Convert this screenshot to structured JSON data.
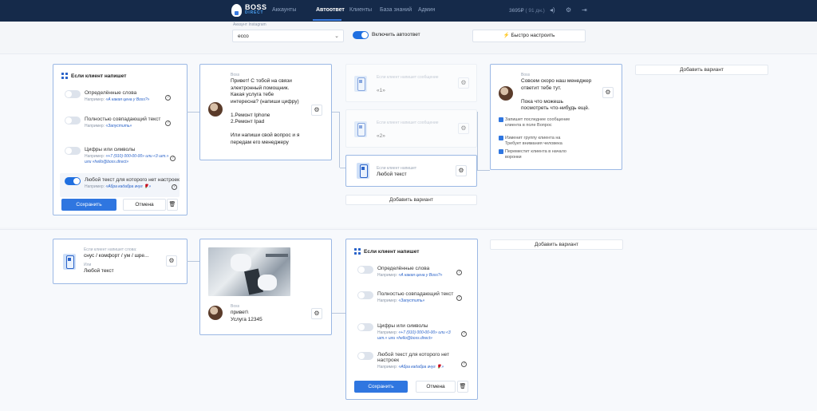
{
  "header": {
    "logo_line1": "BOSS",
    "logo_line2": "DIRECT",
    "nav": [
      {
        "label": "Аккаунты",
        "active": false
      },
      {
        "label": "Автоответ",
        "active": true
      },
      {
        "label": "Клиенты",
        "active": false
      },
      {
        "label": "База знаний",
        "active": false
      },
      {
        "label": "Админ",
        "active": false
      }
    ],
    "balance": "3695₽",
    "balance_days": "( 91 дн.)"
  },
  "account": {
    "label": "Аккаунт Instagram",
    "value": "ecco",
    "autoreply_label": "Включить автоответ",
    "autoreply_on": true,
    "quick_setup": "Быстро настроить"
  },
  "trigger_card": {
    "title": "Если клиент напишет",
    "options": [
      {
        "name": "Определённые слова",
        "hint_prefix": "Например: ",
        "hint": "«А какая цена у Boss?»",
        "on": false
      },
      {
        "name": "Полностью совпадающий текст",
        "hint_prefix": "Например: ",
        "hint": "«Запустить»",
        "on": false
      },
      {
        "name": "Цифры или символы",
        "hint_prefix": "Например: ",
        "hint": "«+7 (910) 000-00-00» или «3 шт.» или «hello@boss.direct»",
        "on": false
      },
      {
        "name": "Любой текст для которого нет настроек",
        "hint_prefix": "Например: ",
        "hint": "«Абра кадабра ачуг 🌹»",
        "on": true
      }
    ],
    "save": "Сохранить",
    "cancel": "Отмена"
  },
  "reply1": {
    "author": "Boss",
    "text": "Привет! С тобой на связи\nэлектронный помощник.\nКакая услуга тебе\nинтересна? (напиши цифру)\n\n1.Ремонт Iphone\n2.Ремонт Ipad\n\nИли напиши свой вопрос и я\nпередам его менеджеру"
  },
  "branches": [
    {
      "label": "Если клиент напишет сообщение",
      "value": "«1»",
      "ghost": true
    },
    {
      "label": "Если клиент напишет сообщение",
      "value": "«2»",
      "ghost": true
    },
    {
      "label": "Если клиент напишет",
      "value": "Любой текст",
      "ghost": false
    }
  ],
  "add_variant": "Добавить вариант",
  "reply2": {
    "author": "Boss",
    "text": "Совсем скоро наш менеджер\nответит тебе тут.\n\nПока что можешь\nпосмотреть что-нибудь ещё.",
    "actions": [
      "Запишет последнее сообщение клиента в поле Вопрос",
      "Изменит группу клиента на Требует внимания человека",
      "Переместит клиента в начало воронки"
    ]
  },
  "row2": {
    "trigger_label": "Если клиент напишет слова:",
    "trigger_value": "снус / комфорт / ум / шре...",
    "or_label": "Или",
    "or_value": "Любой текст",
    "reply_author": "Boss",
    "reply_text": "привет\\\nУслуга 12345"
  },
  "colors": {
    "nav_bg": "#152a4a",
    "accent": "#2f76e0",
    "card_border": "#9bb8e4"
  }
}
